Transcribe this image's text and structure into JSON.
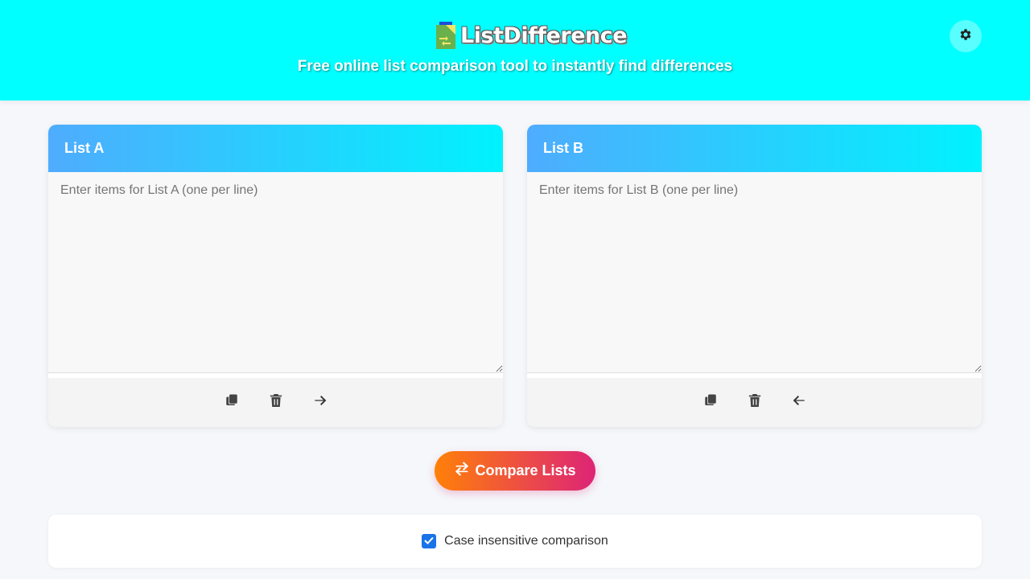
{
  "header": {
    "logo_text": "ListDifference",
    "tagline": "Free online list comparison tool to instantly find differences",
    "theme_toggle_icon": "gear-icon"
  },
  "list_a": {
    "title": "List A",
    "placeholder": "Enter items for List A (one per line)",
    "value": "",
    "actions": [
      "copy-icon",
      "trash-icon",
      "arrow-right-icon"
    ]
  },
  "list_b": {
    "title": "List B",
    "placeholder": "Enter items for List B (one per line)",
    "value": "",
    "actions": [
      "copy-icon",
      "trash-icon",
      "arrow-left-icon"
    ]
  },
  "compare": {
    "label": "Compare Lists",
    "icon": "swap-arrows-icon"
  },
  "options": {
    "case_insensitive_label": "Case insensitive comparison",
    "case_insensitive_checked": true
  },
  "colors": {
    "header_bg": "#00ffff",
    "panel_header_start": "#4facfe",
    "panel_header_end": "#00f2fe",
    "compare_start": "#ff8008",
    "compare_end": "#dd2476",
    "checkbox": "#1a73e8"
  }
}
